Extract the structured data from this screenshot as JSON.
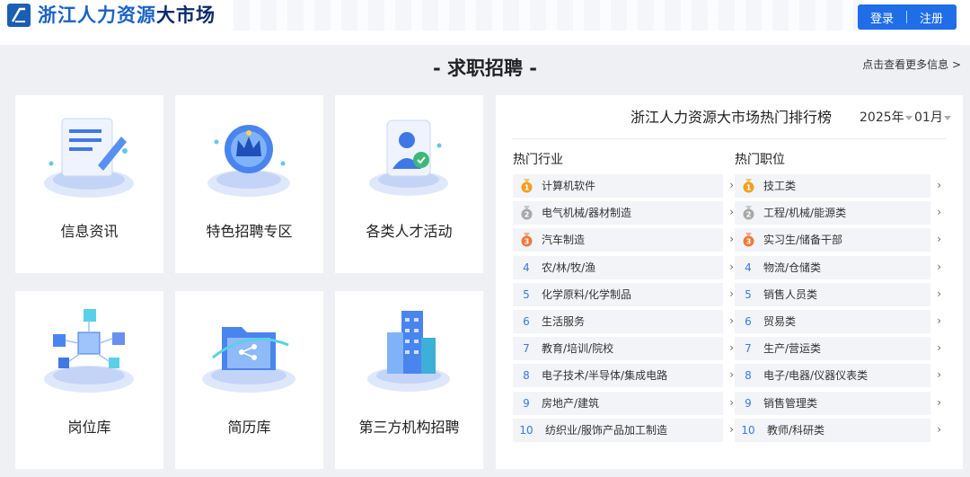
{
  "header": {
    "title_part1": "浙江人力资源",
    "title_part2": "大市场",
    "login_label": "登录",
    "register_label": "注册"
  },
  "section": {
    "title": "- 求职招聘 -",
    "more_link": "点击查看更多信息 >"
  },
  "tiles": [
    {
      "label": "信息资讯",
      "icon": "document-edit-icon"
    },
    {
      "label": "特色招聘专区",
      "icon": "crown-badge-icon"
    },
    {
      "label": "各类人才活动",
      "icon": "person-card-icon"
    },
    {
      "label": "岗位库",
      "icon": "cubes-network-icon"
    },
    {
      "label": "简历库",
      "icon": "folder-share-icon"
    },
    {
      "label": "第三方机构招聘",
      "icon": "buildings-icon"
    }
  ],
  "ranking": {
    "title": "浙江人力资源大市场热门排行榜",
    "year": "2025年",
    "month": "01月",
    "industry_title": "热门行业",
    "position_title": "热门职位",
    "industries": [
      {
        "rank": "1",
        "name": "计算机软件"
      },
      {
        "rank": "2",
        "name": "电气机械/器材制造"
      },
      {
        "rank": "3",
        "name": "汽车制造"
      },
      {
        "rank": "4",
        "name": "农/林/牧/渔"
      },
      {
        "rank": "5",
        "name": "化学原料/化学制品"
      },
      {
        "rank": "6",
        "name": "生活服务"
      },
      {
        "rank": "7",
        "name": "教育/培训/院校"
      },
      {
        "rank": "8",
        "name": "电子技术/半导体/集成电路"
      },
      {
        "rank": "9",
        "name": "房地产/建筑"
      },
      {
        "rank": "10",
        "name": "纺织业/服饰产品加工制造"
      }
    ],
    "positions": [
      {
        "rank": "1",
        "name": "技工类"
      },
      {
        "rank": "2",
        "name": "工程/机械/能源类"
      },
      {
        "rank": "3",
        "name": "实习生/储备干部"
      },
      {
        "rank": "4",
        "name": "物流/仓储类"
      },
      {
        "rank": "5",
        "name": "销售人员类"
      },
      {
        "rank": "6",
        "name": "贸易类"
      },
      {
        "rank": "7",
        "name": "生产/营运类"
      },
      {
        "rank": "8",
        "name": "电子/电器/仪器仪表类"
      },
      {
        "rank": "9",
        "name": "销售管理类"
      },
      {
        "rank": "10",
        "name": "教师/科研类"
      }
    ],
    "arrow": "›",
    "medal_colors": [
      "#f0a020",
      "#a8a8a8",
      "#f07a3a"
    ],
    "number_color": "#3a7be0"
  },
  "colors": {
    "brand_blue": "#1f6ee8",
    "title_blue": "#1b63c6",
    "title_navy": "#0c2b6b"
  }
}
